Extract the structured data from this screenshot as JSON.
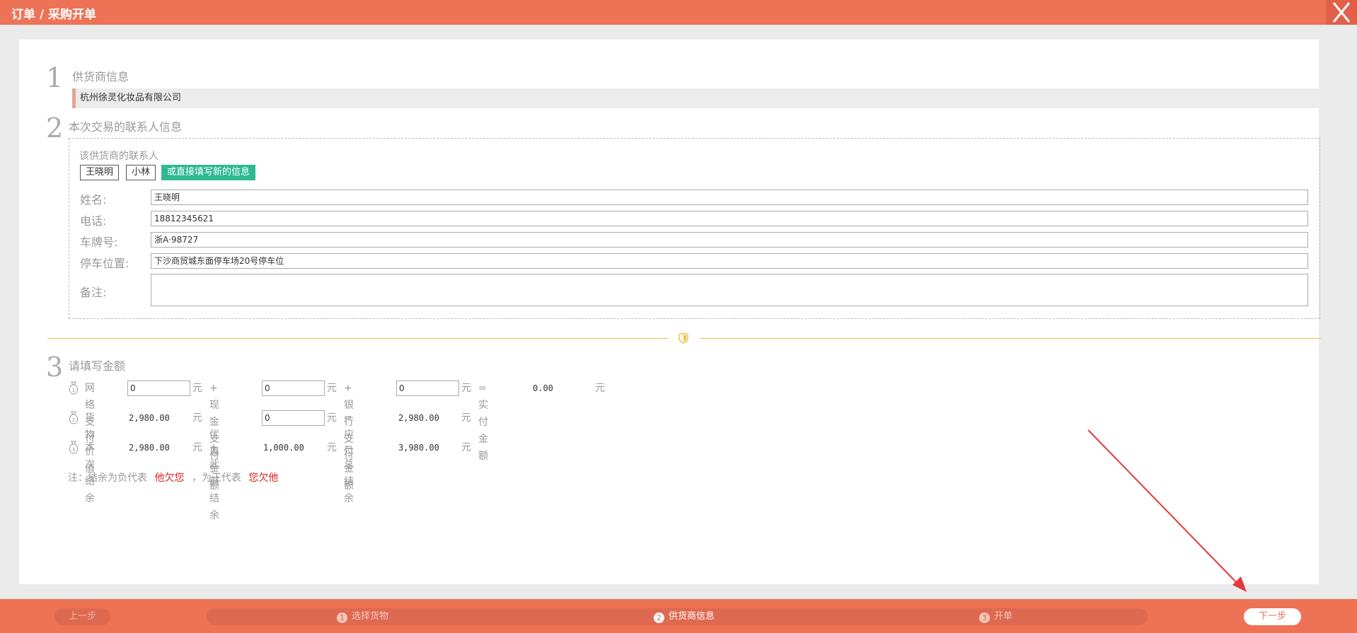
{
  "header": {
    "title": "订单 / 采购开单",
    "close_icon": "close-icon"
  },
  "step1": {
    "num": "1",
    "title": "供货商信息",
    "supplier": "杭州徐灵化妆品有限公司"
  },
  "step2": {
    "num": "2",
    "title": "本次交易的联系人信息",
    "contacts_title": "该供货商的联系人",
    "contacts": [
      "王晓明",
      "小林"
    ],
    "new_info_button": "或直接填写新的信息",
    "fields": {
      "name_label": "姓名:",
      "name_value": "王晓明",
      "phone_label": "电话:",
      "phone_value": "18812345621",
      "plate_label": "车牌号:",
      "plate_value": "浙A·98727",
      "parking_label": "停车位置:",
      "parking_value": "下沙商贸城东面停车场20号停车位",
      "remark_label": "备注:",
      "remark_value": ""
    }
  },
  "step3": {
    "num": "3",
    "title": "请填写金额",
    "row1": {
      "online_label": "网络支付",
      "online_value": "0",
      "unit": "元",
      "cash_label": "+ 现金支付",
      "cash_value": "0",
      "bank_label": "+ 银行支付",
      "bank_value": "0",
      "actual_label": "= 实付金额",
      "actual_value": "0.00"
    },
    "row2": {
      "goods_label": "货物价值",
      "goods_value": "2,980.00",
      "discount_label": "- 优惠金额",
      "discount_value": "0",
      "payable_label": "= 应付金额",
      "payable_value": "2,980.00"
    },
    "row3": {
      "balance_label": "本次结余",
      "balance_value": "2,980.00",
      "prev_label": "+ 此前结余",
      "prev_value": "1,000.00",
      "total_label": "= 总结余",
      "total_value": "3,980.00"
    },
    "note": {
      "prefix": "注：结余为负代表",
      "neg": "他欠您",
      "mid": "，为正代表",
      "pos": "您欠他"
    }
  },
  "footer": {
    "prev": "上一步",
    "steps": [
      {
        "num": "1",
        "label": "选择货物"
      },
      {
        "num": "2",
        "label": "供货商信息"
      },
      {
        "num": "3",
        "label": "开单"
      }
    ],
    "active_step": 2,
    "next": "下一步"
  },
  "colors": {
    "accent": "#ee7256",
    "green": "#2fb991",
    "red": "#e02020",
    "divider": "#f0c04a"
  }
}
